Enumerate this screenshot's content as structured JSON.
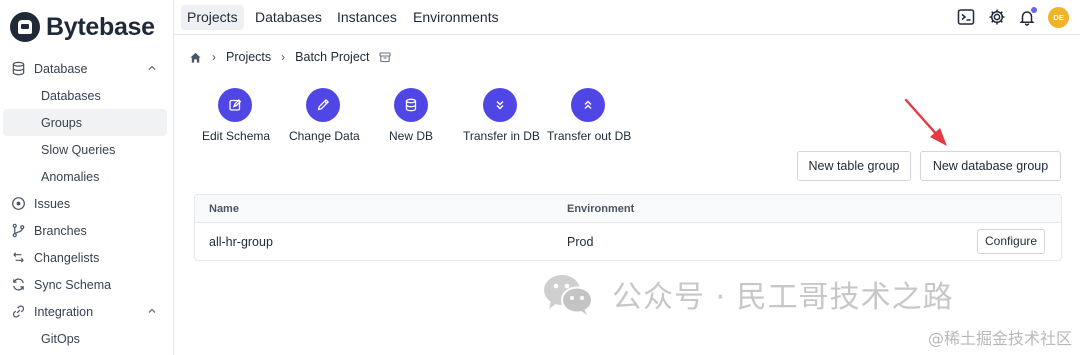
{
  "app": {
    "brand": "Bytebase"
  },
  "sidebar": {
    "items": [
      {
        "label": "Database",
        "icon": "database-icon",
        "expanded": true
      },
      {
        "label": "Databases"
      },
      {
        "label": "Groups",
        "active": true
      },
      {
        "label": "Slow Queries"
      },
      {
        "label": "Anomalies"
      },
      {
        "label": "Issues",
        "icon": "issue-circle-icon"
      },
      {
        "label": "Branches",
        "icon": "git-branch-icon"
      },
      {
        "label": "Changelists",
        "icon": "changelist-icon"
      },
      {
        "label": "Sync Schema",
        "icon": "refresh-icon"
      },
      {
        "label": "Integration",
        "icon": "link-icon",
        "expanded": true
      },
      {
        "label": "GitOps"
      }
    ]
  },
  "topbar": {
    "tabs": [
      {
        "label": "Projects",
        "active": true
      },
      {
        "label": "Databases"
      },
      {
        "label": "Instances"
      },
      {
        "label": "Environments"
      }
    ],
    "avatar_initials": "DE",
    "accent_color": "#4f46e5"
  },
  "breadcrumb": {
    "home_icon": "home-icon",
    "items": [
      "Projects",
      "Batch Project"
    ]
  },
  "quick_actions": [
    {
      "label": "Edit Schema",
      "icon": "edit-square-icon"
    },
    {
      "label": "Change Data",
      "icon": "pencil-icon"
    },
    {
      "label": "New DB",
      "icon": "database-icon"
    },
    {
      "label": "Transfer in DB",
      "icon": "chevrons-down-icon"
    },
    {
      "label": "Transfer out DB",
      "icon": "chevrons-up-icon"
    }
  ],
  "actions": {
    "new_table_group": "New table group",
    "new_database_group": "New database group"
  },
  "table": {
    "columns": [
      "Name",
      "Environment"
    ],
    "rows": [
      {
        "name": "all-hr-group",
        "environment": "Prod",
        "action": "Configure"
      }
    ]
  },
  "watermark": {
    "main": "公众号 · 民工哥技术之路",
    "corner": "@稀土掘金技术社区"
  }
}
